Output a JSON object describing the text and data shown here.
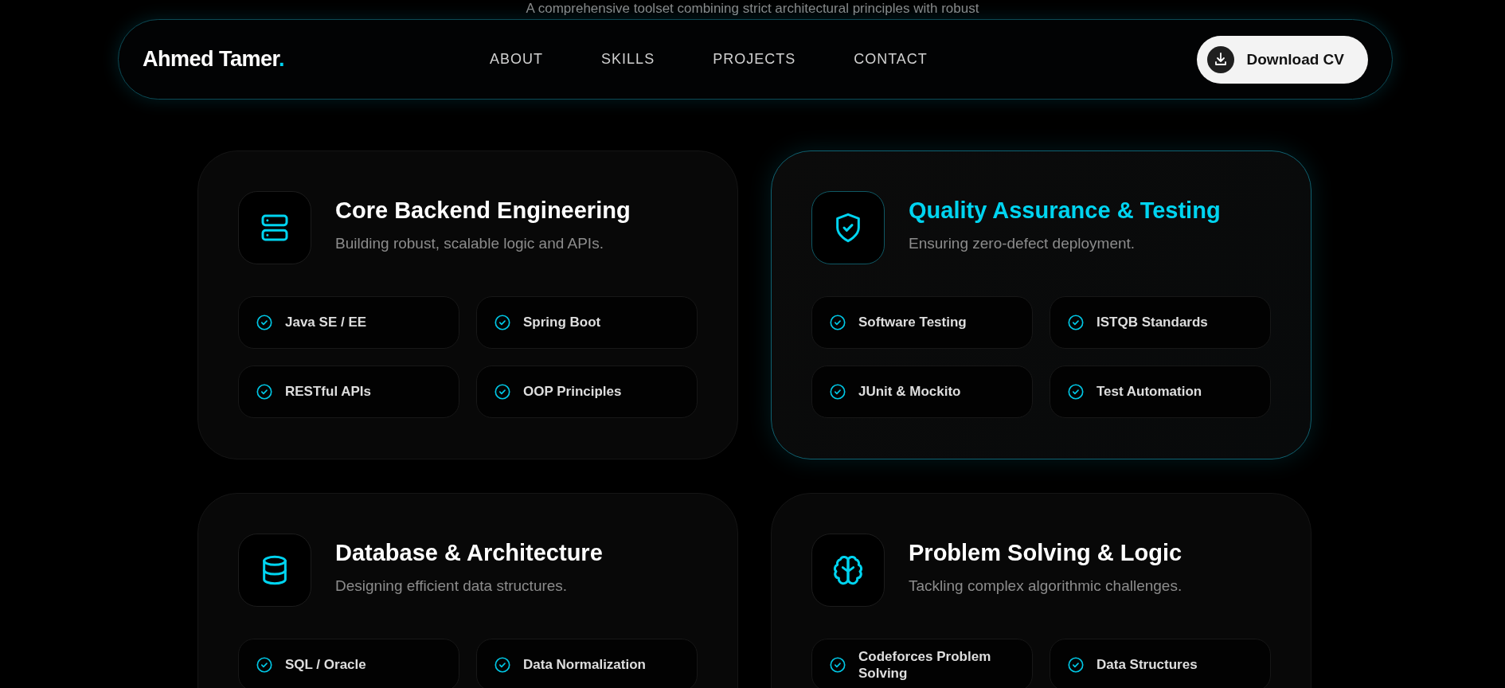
{
  "intro": "A comprehensive toolset combining strict architectural principles with robust",
  "nav": {
    "logo": {
      "name": "Ahmed Tamer",
      "mark": "."
    },
    "links": [
      {
        "label": "ABOUT"
      },
      {
        "label": "SKILLS"
      },
      {
        "label": "PROJECTS"
      },
      {
        "label": "CONTACT"
      }
    ],
    "button": {
      "label": "Download CV"
    }
  },
  "cards": [
    {
      "kind": "server",
      "title": "Core Backend Engineering",
      "subtitle": "Building robust, scalable logic and APIs.",
      "highlighted": false,
      "skills": [
        "Java SE / EE",
        "Spring Boot",
        "RESTful APIs",
        "OOP Principles"
      ]
    },
    {
      "kind": "shield",
      "title": "Quality Assurance & Testing",
      "subtitle": "Ensuring zero-defect deployment.",
      "highlighted": true,
      "skills": [
        "Software Testing",
        "ISTQB Standards",
        "JUnit & Mockito",
        "Test Automation"
      ]
    },
    {
      "kind": "database",
      "title": "Database & Architecture",
      "subtitle": "Designing efficient data structures.",
      "highlighted": false,
      "skills": [
        "SQL / Oracle",
        "Data Normalization"
      ]
    },
    {
      "kind": "brain",
      "title": "Problem Solving & Logic",
      "subtitle": "Tackling complex algorithmic challenges.",
      "highlighted": false,
      "skills": [
        "Codeforces Problem Solving",
        "Data Structures"
      ]
    }
  ]
}
